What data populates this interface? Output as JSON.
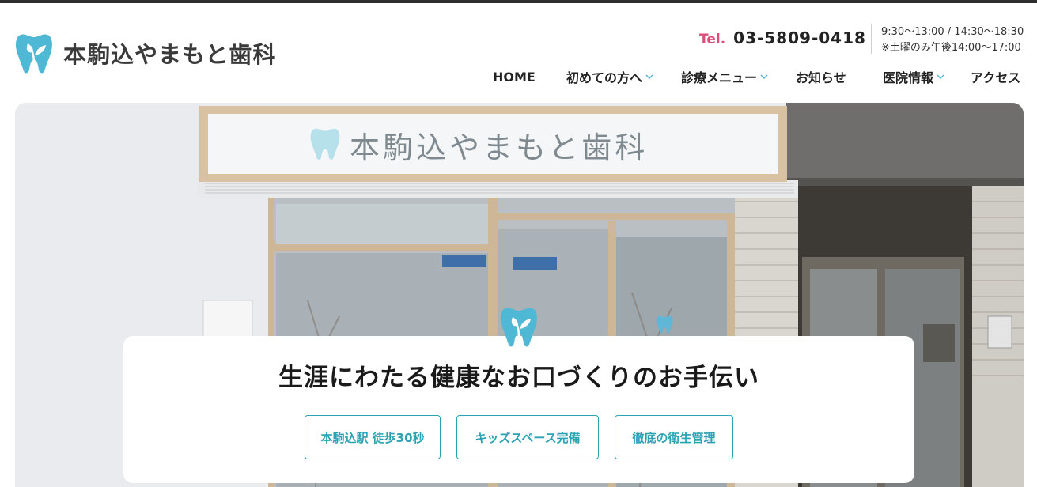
{
  "header": {
    "clinic_name": "本駒込やまもと歯科",
    "tel_label": "Tel.",
    "tel_number": "03-5809-0418",
    "hours_line1": "9:30～13:00 / 14:30～18:30",
    "hours_line2": "※土曜のみ午後14:00～17:00"
  },
  "nav": {
    "items": [
      {
        "label": "HOME",
        "has_dropdown": false
      },
      {
        "label": "初めての方へ",
        "has_dropdown": true
      },
      {
        "label": "診療メニュー",
        "has_dropdown": true
      },
      {
        "label": "お知らせ",
        "has_dropdown": false
      },
      {
        "label": "医院情報",
        "has_dropdown": true
      },
      {
        "label": "アクセス",
        "has_dropdown": false
      }
    ]
  },
  "hero": {
    "sign_text": "本駒込やまもと歯科",
    "tagline": "生涯にわたる健康なお口づくりのお手伝い",
    "features": [
      "本駒込駅 徒歩30秒",
      "キッズスペース完備",
      "徹底の衛生管理"
    ]
  },
  "colors": {
    "accent": "#2aa3b3",
    "tel_label": "#d94f7a",
    "logo_blue": "#4fb8d4"
  }
}
